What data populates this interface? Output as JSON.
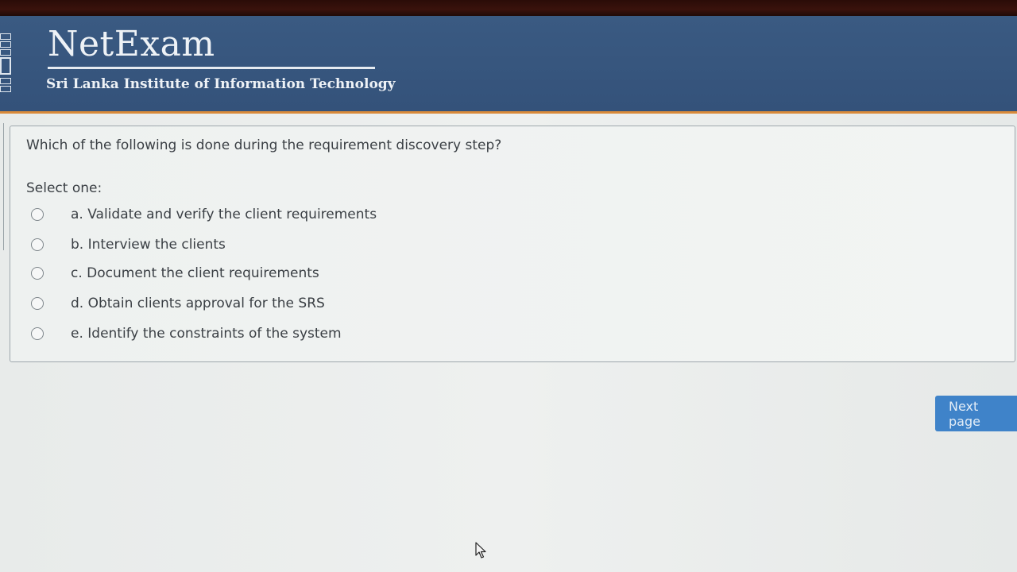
{
  "header": {
    "brand_title": "NetExam",
    "brand_subtitle": "Sri Lanka Institute of Information Technology",
    "colors": {
      "background": "#3a5a82",
      "accent_border": "#d98a3a"
    }
  },
  "question": {
    "text": "Which of the following is done during the requirement discovery step?",
    "select_label": "Select one:",
    "options": [
      {
        "label": "a. Validate and verify the client requirements",
        "selected": false
      },
      {
        "label": "b. Interview the clients",
        "selected": false
      },
      {
        "label": "c. Document the client requirements",
        "selected": false
      },
      {
        "label": "d. Obtain clients approval for the  SRS",
        "selected": false
      },
      {
        "label": "e. Identify the constraints of the system",
        "selected": false
      }
    ]
  },
  "navigation": {
    "next_label": "Next page",
    "colors": {
      "button": "#3f83c9"
    }
  },
  "icons": {
    "cursor": "mouse-pointer-icon",
    "logo": "sliit-logo-icon"
  }
}
